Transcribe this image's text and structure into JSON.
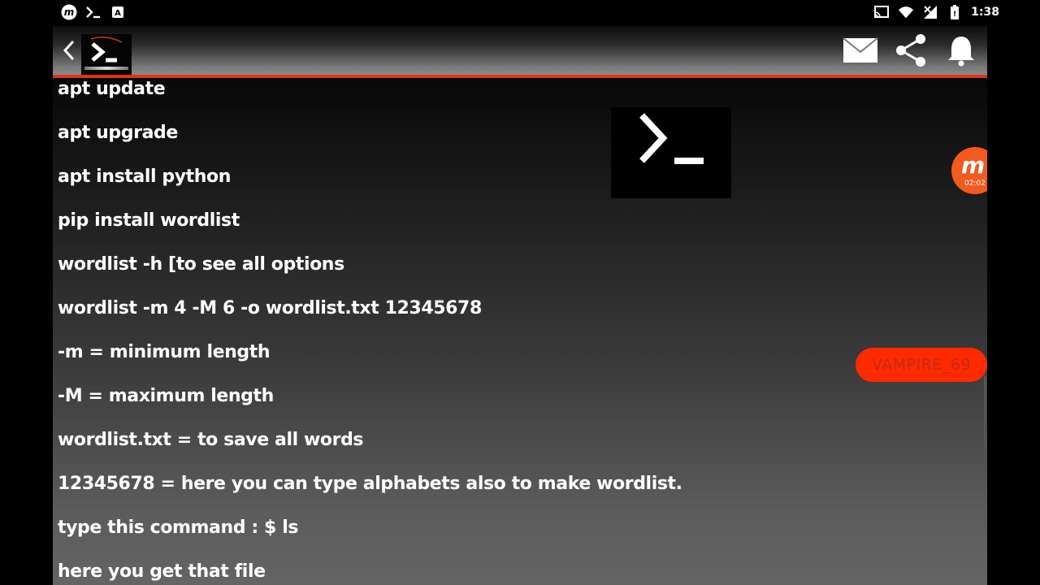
{
  "status_bar": {
    "time": "1:38",
    "left_icons": [
      "mobizen-icon",
      "terminal-icon",
      "a-icon"
    ],
    "right_icons": [
      "cast-icon",
      "wifi-icon",
      "no-signal-icon",
      "battery-icon"
    ]
  },
  "app_bar": {
    "actions": [
      "mail-icon",
      "share-icon",
      "bell-icon"
    ],
    "accent": "#e0321c"
  },
  "content": {
    "lines": [
      "apt update",
      "apt upgrade",
      "apt install python",
      "pip install wordlist",
      "wordlist -h [to see all options",
      "wordlist -m 4 -M 6 -o wordlist.txt 12345678",
      "-m = minimum length",
      "-M = maximum length",
      "wordlist.txt = to save all words",
      "12345678 = here you can type alphabets also to make wordlist.",
      "type this command : $ ls",
      "here you get that file"
    ]
  },
  "overlay": {
    "recorder_time": "02:02",
    "tag": "VAMPIRE_69",
    "recorder_color": "#f25a1f",
    "tag_color": "#ff2a00"
  }
}
